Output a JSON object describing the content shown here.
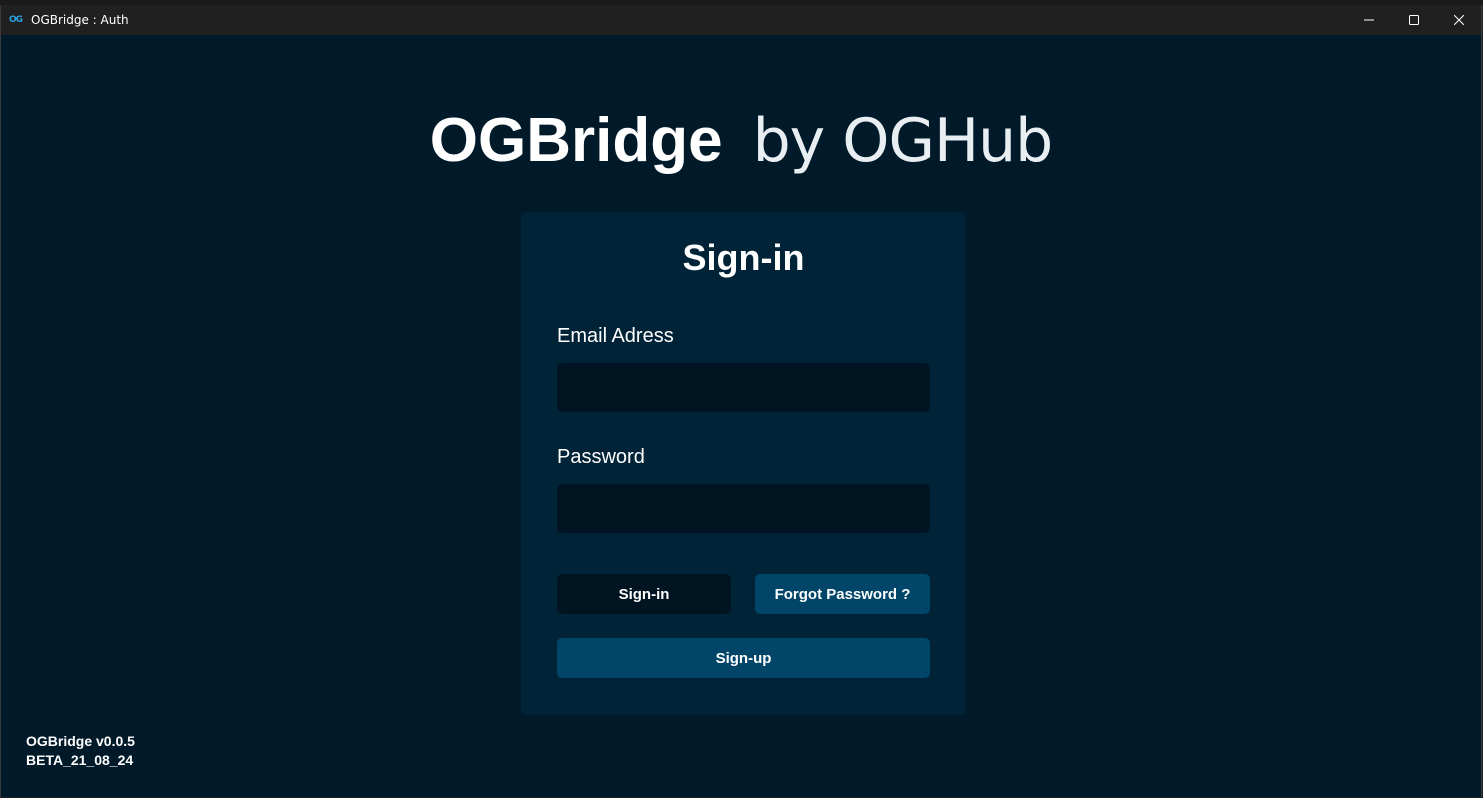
{
  "window": {
    "title": "OGBridge : Auth",
    "icon_text": "OG",
    "controls": {
      "minimize_icon": "minimize-icon",
      "maximize_icon": "maximize-icon",
      "close_icon": "close-icon"
    }
  },
  "brand": {
    "name": "OGBridge",
    "tagline": "by OGHub"
  },
  "signin_form": {
    "title": "Sign-in",
    "email": {
      "label": "Email Adress",
      "value": "",
      "placeholder": ""
    },
    "password": {
      "label": "Password",
      "value": "",
      "placeholder": ""
    },
    "signin_label": "Sign-in",
    "forgot_label": "Forgot Password ?",
    "signup_label": "Sign-up"
  },
  "footer": {
    "version": "OGBridge v0.0.5",
    "build": "BETA_21_08_24"
  },
  "colors": {
    "background": "#001a29",
    "card": "#002337",
    "input": "#001521",
    "accent_button": "#014668",
    "titlebar": "#202020",
    "icon_accent": "#29a3e0"
  }
}
